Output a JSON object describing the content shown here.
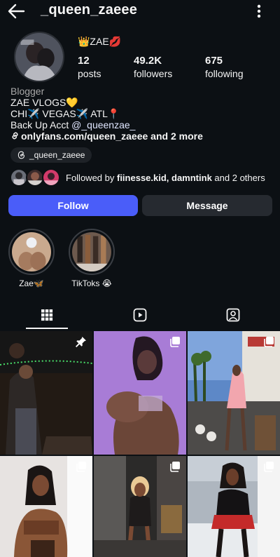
{
  "header": {
    "username": "_queen_zaeee"
  },
  "profile": {
    "display_name": "👑ZAE💋",
    "stats": [
      {
        "value": "12",
        "label": "posts"
      },
      {
        "value": "49.2K",
        "label": "followers"
      },
      {
        "value": "675",
        "label": "following"
      }
    ]
  },
  "bio": {
    "category": "Blogger",
    "line1": "ZAE VLOGS💛",
    "line2": "CHI✈️ VEGAS✈️ ATL📍",
    "line3_prefix": "Back Up Acct ",
    "line3_handle": "@_queenzae_",
    "link": "onlyfans.com/queen_zaeee and 2 more"
  },
  "threads_badge": {
    "label": "_queen_zaeee"
  },
  "followed_by": {
    "prefix": "Followed by ",
    "names": "fiinesse.kid, damntink",
    "suffix": " and 2 others"
  },
  "buttons": {
    "follow": "Follow",
    "message": "Message"
  },
  "highlights": [
    {
      "label": "Zae🦋"
    },
    {
      "label": "TikToks 😭"
    }
  ],
  "tabs": {
    "active": "grid",
    "items": [
      "grid-icon",
      "reels-icon",
      "tagged-icon"
    ]
  },
  "grid_posts": [
    {
      "id": "post-1",
      "overlay_icon": "pin-icon"
    },
    {
      "id": "post-2",
      "overlay_icon": "multi-photo-icon"
    },
    {
      "id": "post-3",
      "overlay_icon": "multi-photo-icon"
    },
    {
      "id": "post-4",
      "overlay_icon": "multi-photo-icon"
    },
    {
      "id": "post-5",
      "overlay_icon": "multi-photo-icon"
    },
    {
      "id": "post-6",
      "overlay_icon": "multi-photo-icon"
    }
  ],
  "colors": {
    "background": "#0c1014",
    "accent": "#4a5df9",
    "secondary_button": "#262a30",
    "text": "#f5f5f5"
  }
}
